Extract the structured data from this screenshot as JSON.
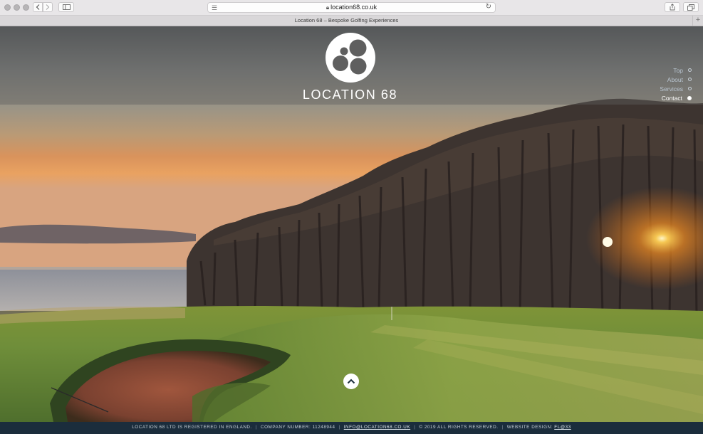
{
  "browser": {
    "url": "location68.co.uk",
    "tab_title": "Location 68 – Bespoke Golfing Experiences",
    "new_tab_symbol": "+"
  },
  "logo": {
    "text": "LOCATION 68"
  },
  "nav": {
    "items": [
      {
        "label": "Top",
        "active": false
      },
      {
        "label": "About",
        "active": false
      },
      {
        "label": "Services",
        "active": false
      },
      {
        "label": "Contact",
        "active": true
      }
    ]
  },
  "footer": {
    "registered": "LOCATION 68 LTD IS REGISTERED IN ENGLAND.",
    "company_number": "COMPANY NUMBER: 11248944",
    "email": "INFO@LOCATION68.CO.UK",
    "rights": "© 2019 ALL RIGHTS RESERVED.",
    "design_label": "WEBSITE DESIGN:",
    "design_link": "FL@33",
    "separator": "|"
  },
  "icons": {
    "scroll_up": "chevron-up-icon",
    "lock": "lock-icon",
    "reader": "reader-view-icon",
    "reload": "reload-icon",
    "share": "share-icon",
    "tabs": "show-tabs-icon",
    "back": "back-icon",
    "forward": "forward-icon",
    "sidebar": "sidebar-icon"
  },
  "colors": {
    "footer_bg": "#1b2d3c",
    "header_overlay": "#5f5f5f",
    "nav_active": "#ffffff"
  }
}
